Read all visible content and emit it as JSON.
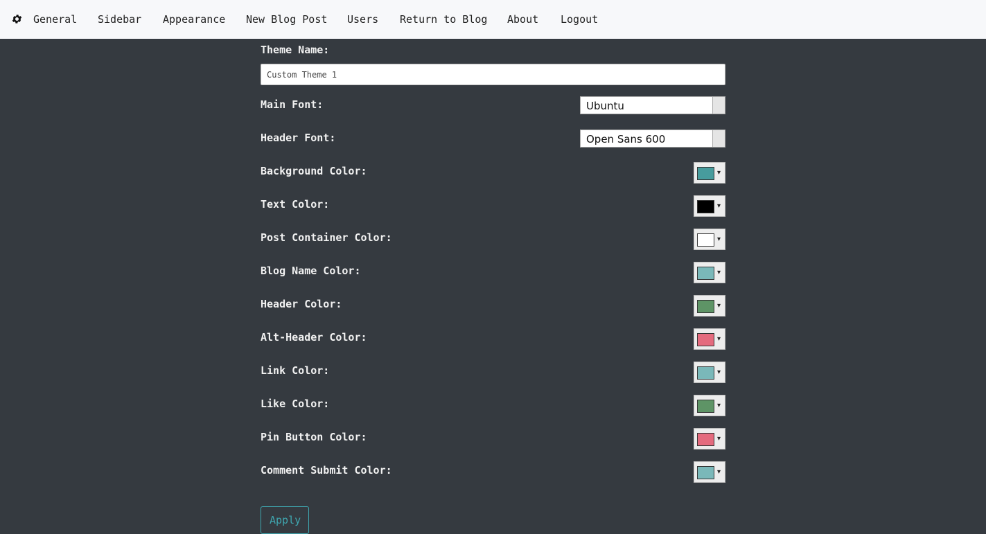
{
  "nav": {
    "items": [
      "General",
      "Sidebar",
      "Appearance",
      "New Blog Post",
      "Users",
      "Return to Blog",
      "About",
      "Logout"
    ]
  },
  "form": {
    "theme_name_label": "Theme Name:",
    "theme_name_value": "Custom Theme 1",
    "main_font_label": "Main Font:",
    "main_font_value": "Ubuntu",
    "header_font_label": "Header Font:",
    "header_font_value": "Open Sans 600",
    "colors": [
      {
        "label": "Background Color:",
        "color": "#479c9d"
      },
      {
        "label": "Text Color:",
        "color": "#000000"
      },
      {
        "label": "Post Container Color:",
        "color": "#ffffff"
      },
      {
        "label": "Blog Name Color:",
        "color": "#7ab8b9"
      },
      {
        "label": "Header Color:",
        "color": "#5e9466"
      },
      {
        "label": "Alt-Header Color:",
        "color": "#e46b7e"
      },
      {
        "label": "Link Color:",
        "color": "#7ab8b9"
      },
      {
        "label": "Like Color:",
        "color": "#5e9466"
      },
      {
        "label": "Pin Button Color:",
        "color": "#e46b7e"
      },
      {
        "label": "Comment Submit Color:",
        "color": "#7ab8b9"
      }
    ],
    "apply_label": "Apply"
  },
  "icons": {
    "settings": "gear-icon",
    "dropdown": "chevron-down-icon"
  },
  "accent_color": "#3fa7b0"
}
